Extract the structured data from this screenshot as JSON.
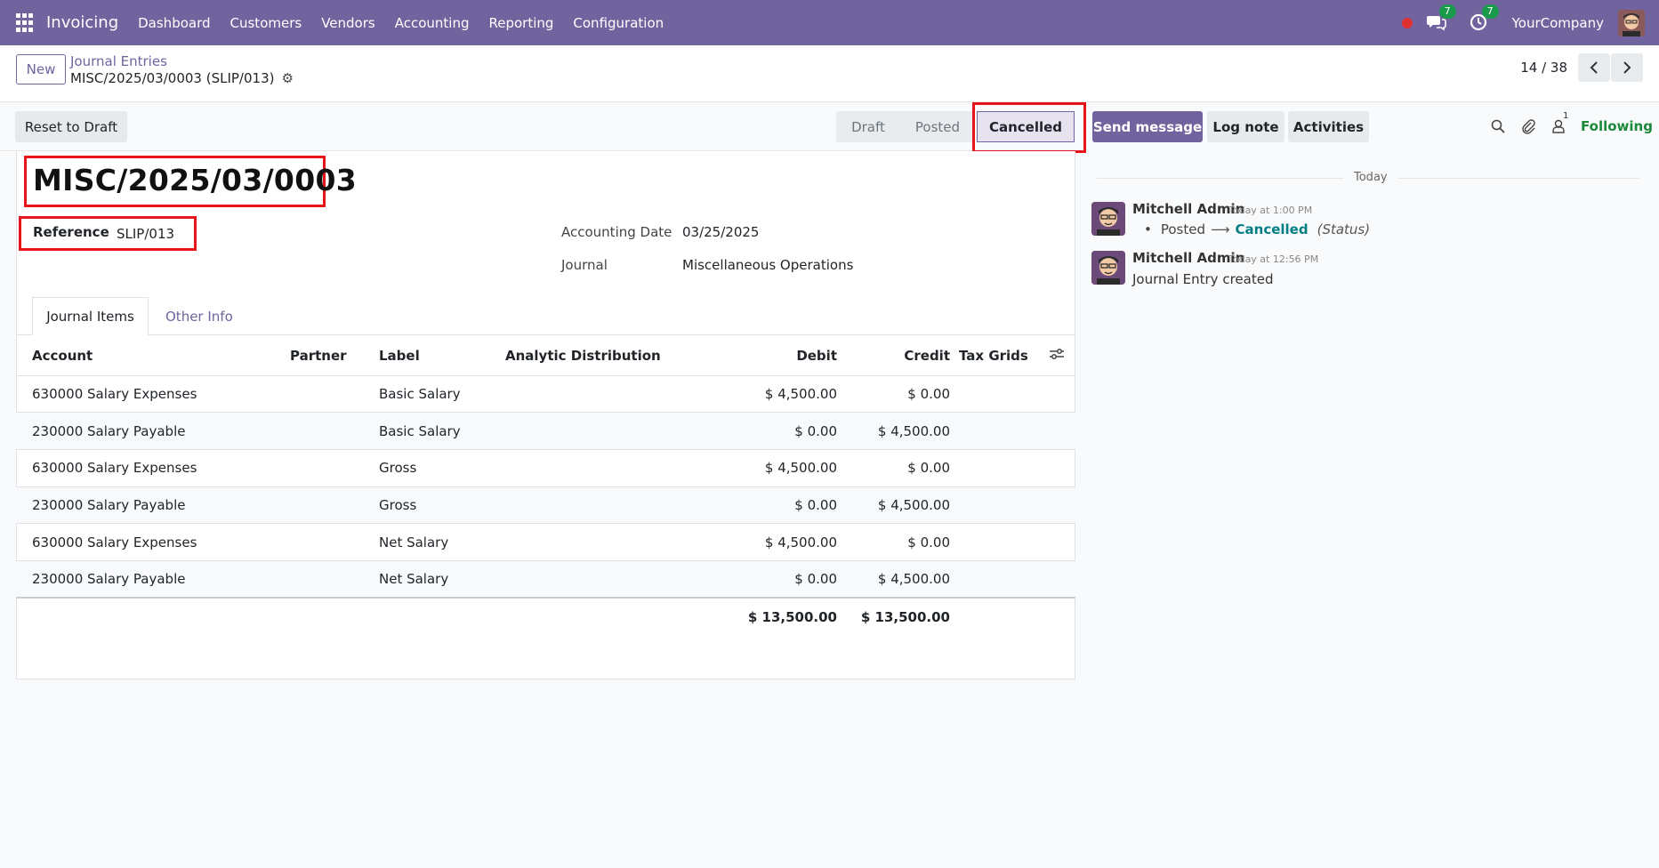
{
  "navbar": {
    "app_name": "Invoicing",
    "menu": [
      "Dashboard",
      "Customers",
      "Vendors",
      "Accounting",
      "Reporting",
      "Configuration"
    ],
    "messages_badge": "7",
    "activities_badge": "7",
    "company": "YourCompany"
  },
  "control": {
    "new_label": "New",
    "breadcrumb": "Journal Entries",
    "record_title": "MISC/2025/03/0003 (SLIP/013)",
    "pager_value": "14 / 38"
  },
  "statusbar": {
    "reset_label": "Reset to Draft",
    "stages": [
      "Draft",
      "Posted",
      "Cancelled"
    ],
    "current_stage": "Cancelled"
  },
  "chatter": {
    "send_message": "Send message",
    "log_note": "Log note",
    "activities": "Activities",
    "follower_count": "1",
    "following": "Following",
    "today": "Today",
    "messages": [
      {
        "author": "Mitchell Admin",
        "time": "Today at 1:00 PM",
        "tracking": {
          "old": "Posted",
          "new": "Cancelled",
          "field": "(Status)"
        }
      },
      {
        "author": "Mitchell Admin",
        "time": "Today at 12:56 PM",
        "body": "Journal Entry created"
      }
    ]
  },
  "form": {
    "title": "MISC/2025/03/0003",
    "reference_label": "Reference",
    "reference_value": "SLIP/013",
    "accounting_date_label": "Accounting Date",
    "accounting_date_value": "03/25/2025",
    "journal_label": "Journal",
    "journal_value": "Miscellaneous Operations"
  },
  "tabs": {
    "journal_items": "Journal Items",
    "other_info": "Other Info"
  },
  "table": {
    "headers": {
      "account": "Account",
      "partner": "Partner",
      "label": "Label",
      "analytic": "Analytic Distribution",
      "debit": "Debit",
      "credit": "Credit",
      "tax": "Tax Grids"
    },
    "rows": [
      {
        "account": "630000 Salary Expenses",
        "partner": "",
        "label": "Basic Salary",
        "debit": "$ 4,500.00",
        "credit": "$ 0.00"
      },
      {
        "account": "230000 Salary Payable",
        "partner": "",
        "label": "Basic Salary",
        "debit": "$ 0.00",
        "credit": "$ 4,500.00"
      },
      {
        "account": "630000 Salary Expenses",
        "partner": "",
        "label": "Gross",
        "debit": "$ 4,500.00",
        "credit": "$ 0.00"
      },
      {
        "account": "230000 Salary Payable",
        "partner": "",
        "label": "Gross",
        "debit": "$ 0.00",
        "credit": "$ 4,500.00"
      },
      {
        "account": "630000 Salary Expenses",
        "partner": "",
        "label": "Net Salary",
        "debit": "$ 4,500.00",
        "credit": "$ 0.00"
      },
      {
        "account": "230000 Salary Payable",
        "partner": "",
        "label": "Net Salary",
        "debit": "$ 0.00",
        "credit": "$ 4,500.00"
      }
    ],
    "total_debit": "$ 13,500.00",
    "total_credit": "$ 13,500.00"
  },
  "colors": {
    "brand": "#71639e",
    "highlight": "#e8141c",
    "following": "#1a8a3a",
    "tracking_new": "#017e84"
  }
}
